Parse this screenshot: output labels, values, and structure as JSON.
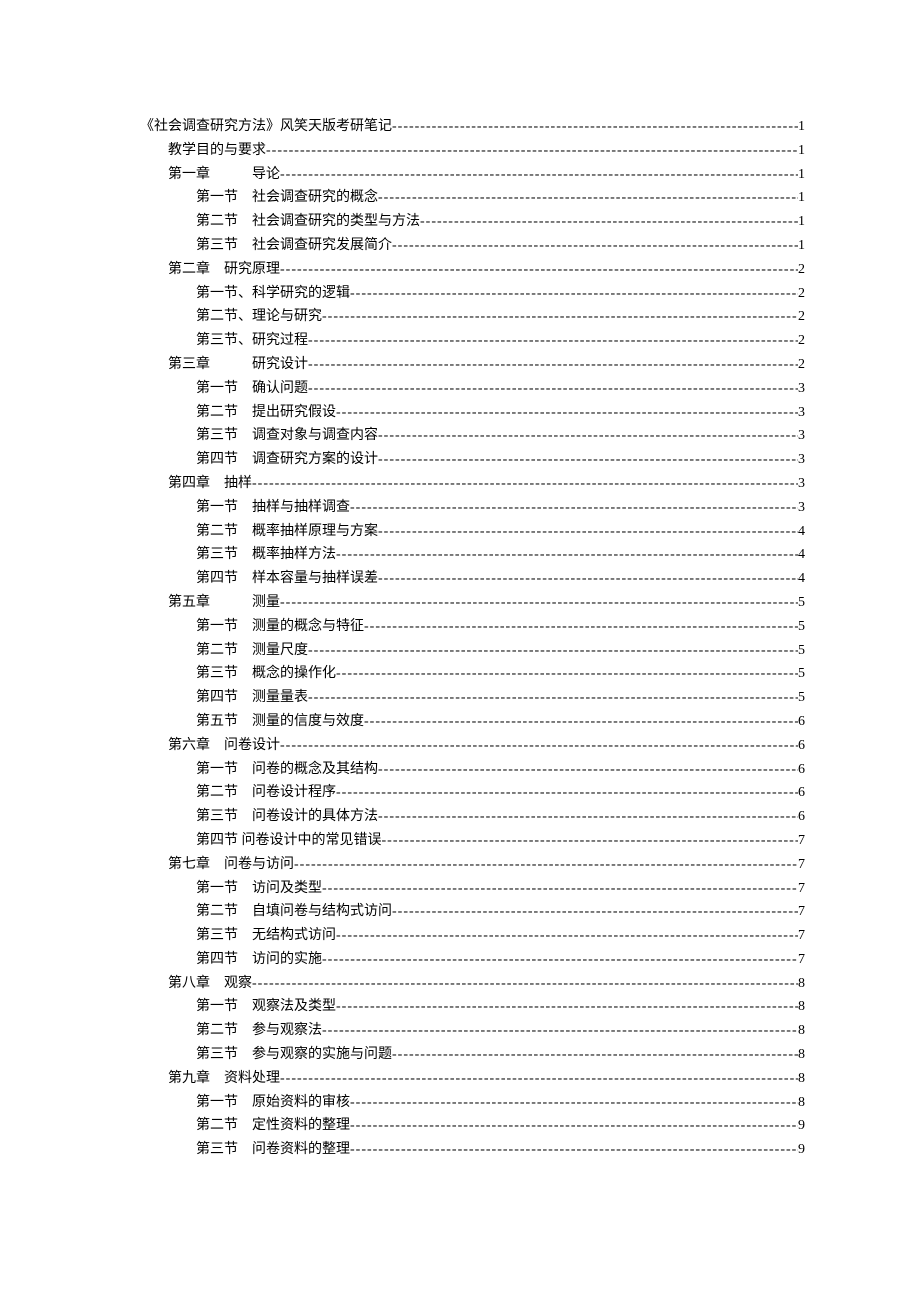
{
  "toc": [
    {
      "indent": 0,
      "label": "《社会调查研究方法》风笑天版考研笔记",
      "page": "1"
    },
    {
      "indent": 1,
      "label": "教学目的与要求",
      "page": "1"
    },
    {
      "indent": 1,
      "label": "第一章　　　导论",
      "page": "1"
    },
    {
      "indent": 2,
      "label": "第一节　社会调查研究的概念",
      "page": "1"
    },
    {
      "indent": 2,
      "label": "第二节　社会调查研究的类型与方法",
      "page": "1"
    },
    {
      "indent": 2,
      "label": "第三节　社会调查研究发展简介",
      "page": "1"
    },
    {
      "indent": 1,
      "label": "第二章　研究原理",
      "page": "2"
    },
    {
      "indent": 2,
      "label": "第一节、科学研究的逻辑",
      "page": "2"
    },
    {
      "indent": 2,
      "label": "第二节、理论与研究",
      "page": "2"
    },
    {
      "indent": 2,
      "label": "第三节、研究过程",
      "page": "2"
    },
    {
      "indent": 1,
      "label": "第三章　　　研究设计",
      "page": "2"
    },
    {
      "indent": 2,
      "label": "第一节　确认问题",
      "page": "3"
    },
    {
      "indent": 2,
      "label": "第二节　提出研究假设",
      "page": "3"
    },
    {
      "indent": 2,
      "label": "第三节　调查对象与调查内容",
      "page": "3"
    },
    {
      "indent": 2,
      "label": "第四节　调查研究方案的设计",
      "page": "3"
    },
    {
      "indent": 1,
      "label": "第四章　抽样",
      "page": "3"
    },
    {
      "indent": 2,
      "label": "第一节　抽样与抽样调查",
      "page": "3"
    },
    {
      "indent": 2,
      "label": "第二节　概率抽样原理与方案",
      "page": "4"
    },
    {
      "indent": 2,
      "label": "第三节　概率抽样方法",
      "page": "4"
    },
    {
      "indent": 2,
      "label": "第四节　样本容量与抽样误差",
      "page": "4"
    },
    {
      "indent": 1,
      "label": "第五章　　　测量",
      "page": "5"
    },
    {
      "indent": 2,
      "label": "第一节　测量的概念与特征",
      "page": "5"
    },
    {
      "indent": 2,
      "label": "第二节　测量尺度",
      "page": "5"
    },
    {
      "indent": 2,
      "label": "第三节　概念的操作化",
      "page": "5"
    },
    {
      "indent": 2,
      "label": "第四节　测量量表",
      "page": "5"
    },
    {
      "indent": 2,
      "label": "第五节　测量的信度与效度",
      "page": "6"
    },
    {
      "indent": 1,
      "label": "第六章　问卷设计",
      "page": "6"
    },
    {
      "indent": 2,
      "label": "第一节　问卷的概念及其结构",
      "page": "6"
    },
    {
      "indent": 2,
      "label": "第二节　问卷设计程序",
      "page": "6"
    },
    {
      "indent": 2,
      "label": "第三节　问卷设计的具体方法",
      "page": "6"
    },
    {
      "indent": 2,
      "label": "第四节 问卷设计中的常见错误 ",
      "page": "7"
    },
    {
      "indent": 1,
      "label": "第七章　问卷与访问",
      "page": "7"
    },
    {
      "indent": 2,
      "label": "第一节　访问及类型",
      "page": "7"
    },
    {
      "indent": 2,
      "label": "第二节　自填问卷与结构式访问",
      "page": "7"
    },
    {
      "indent": 2,
      "label": "第三节　无结构式访问",
      "page": "7"
    },
    {
      "indent": 2,
      "label": "第四节　访问的实施",
      "page": "7"
    },
    {
      "indent": 1,
      "label": "第八章　观察",
      "page": "8"
    },
    {
      "indent": 2,
      "label": "第一节　观察法及类型",
      "page": "8"
    },
    {
      "indent": 2,
      "label": "第二节　参与观察法",
      "page": "8"
    },
    {
      "indent": 2,
      "label": "第三节　参与观察的实施与问题",
      "page": "8"
    },
    {
      "indent": 1,
      "label": "第九章　资料处理",
      "page": "8"
    },
    {
      "indent": 2,
      "label": "第一节　原始资料的审核",
      "page": "8"
    },
    {
      "indent": 2,
      "label": "第二节　定性资料的整理",
      "page": "9"
    },
    {
      "indent": 2,
      "label": "第三节　问卷资料的整理",
      "page": "9"
    }
  ]
}
